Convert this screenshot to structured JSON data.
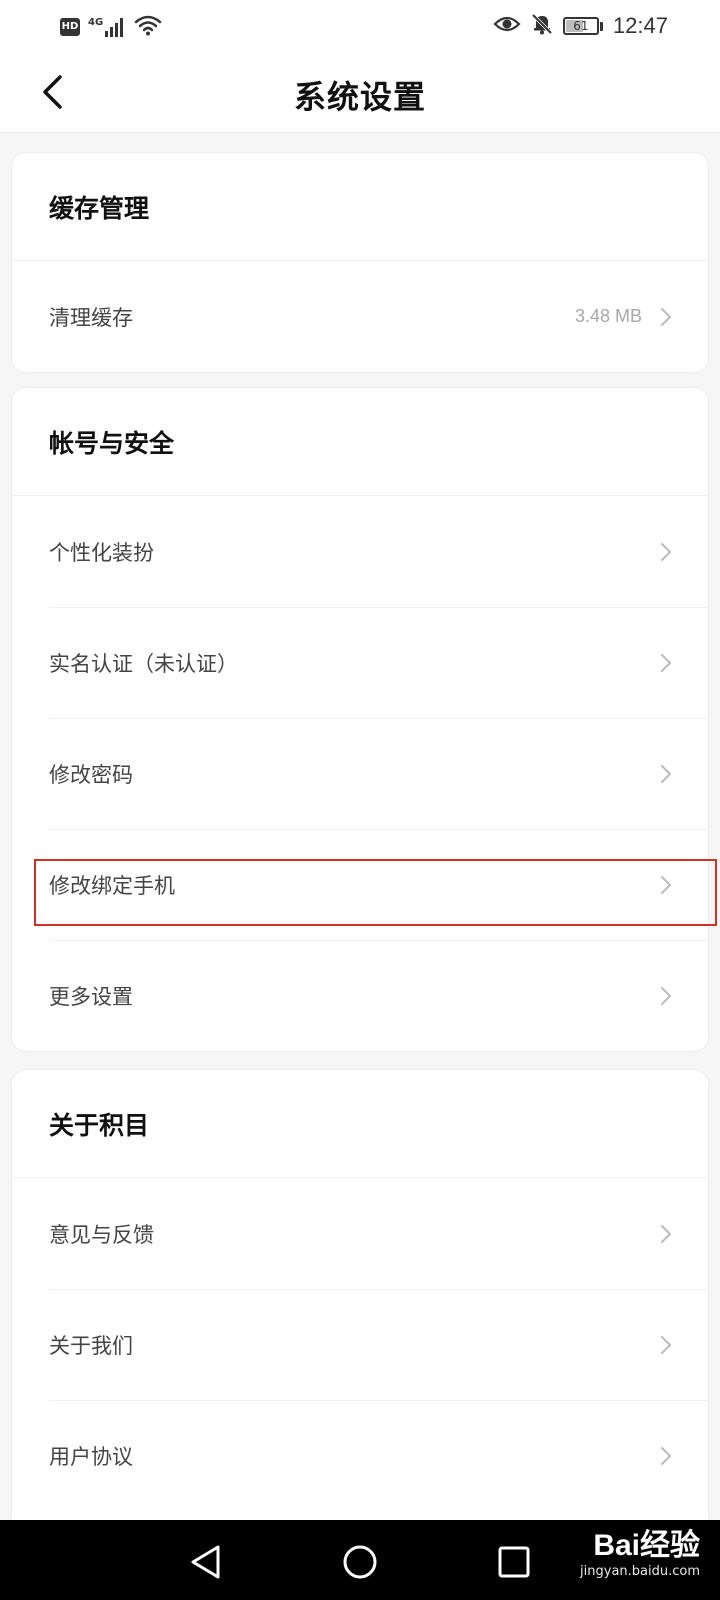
{
  "status_bar": {
    "hd_badge": "HD",
    "network": "4G",
    "battery": "61",
    "battery_percent": 61,
    "time": "12:47",
    "icons": [
      "signal-icon",
      "wifi-icon",
      "eye-icon",
      "bell-off-icon",
      "battery-icon"
    ]
  },
  "header": {
    "title": "系统设置",
    "back_icon": "chevron-left-icon"
  },
  "sections": [
    {
      "title": "缓存管理",
      "items": [
        {
          "label": "清理缓存",
          "value": "3.48 MB"
        }
      ]
    },
    {
      "title": "帐号与安全",
      "items": [
        {
          "label": "个性化装扮"
        },
        {
          "label": "实名认证（未认证）"
        },
        {
          "label": "修改密码"
        },
        {
          "label": "修改绑定手机"
        },
        {
          "label": "更多设置"
        }
      ]
    },
    {
      "title": "关于积目",
      "items": [
        {
          "label": "意见与反馈"
        },
        {
          "label": "关于我们"
        },
        {
          "label": "用户协议"
        }
      ]
    }
  ],
  "watermark": {
    "logo": "Bai经验",
    "url": "jingyan.baidu.com"
  },
  "colors": {
    "highlight": "#d0322b",
    "background": "#f6f6f7",
    "card": "#ffffff"
  }
}
